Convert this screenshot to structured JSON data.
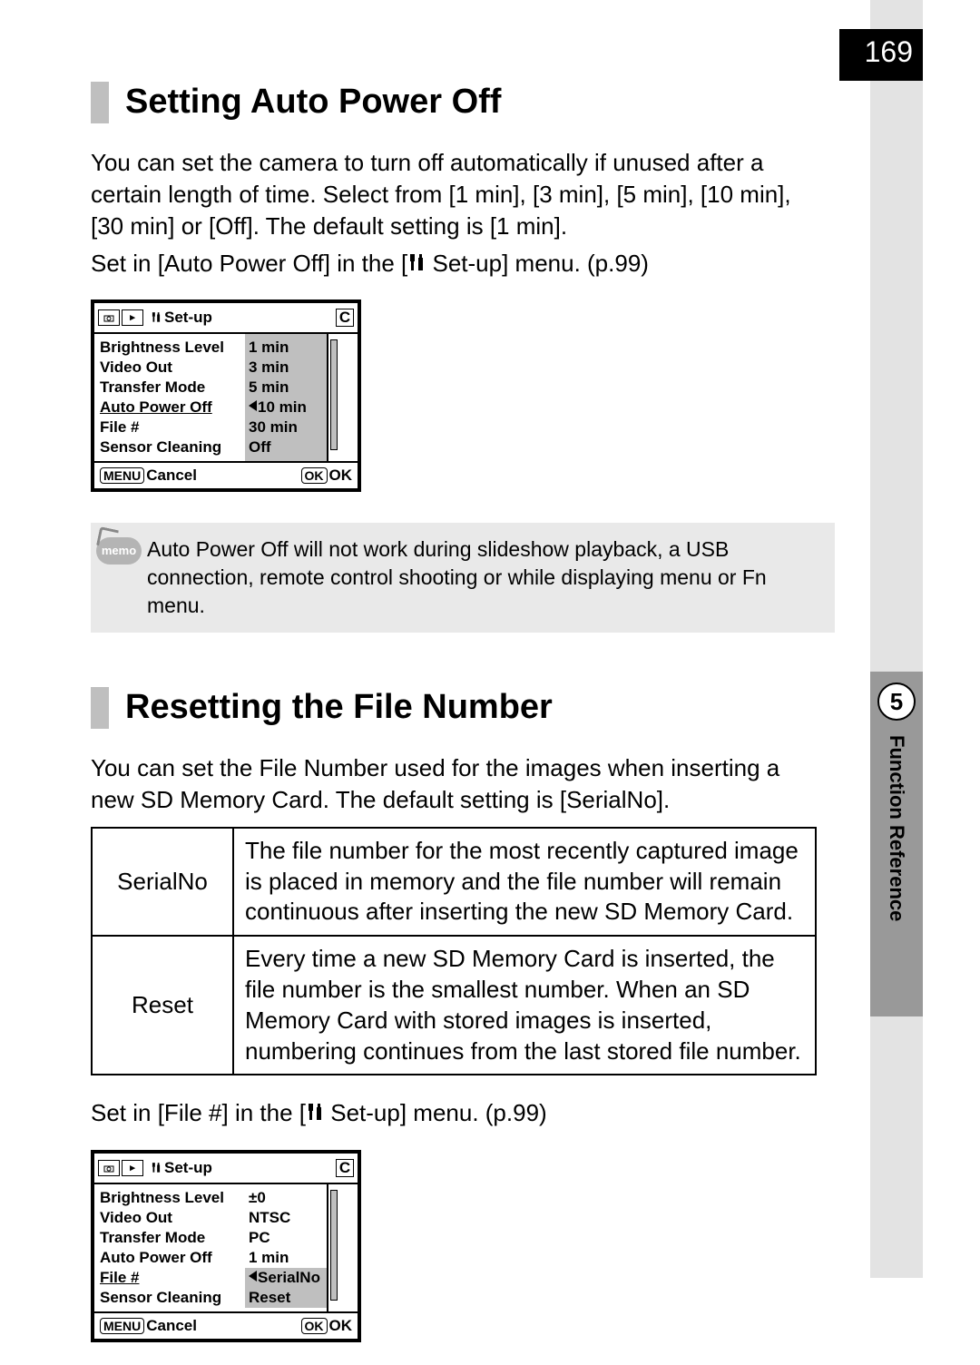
{
  "page_number": "169",
  "chapter": {
    "num": "5",
    "label": "Function Reference"
  },
  "section1": {
    "heading": "Setting Auto Power Off",
    "para1": "You can set the camera to turn off automatically if unused after a certain length of time. Select from [1 min], [3 min], [5 min], [10 min], [30 min] or [Off]. The default setting is [1 min].",
    "para2a": "Set in [Auto Power Off] in the [",
    "para2b": " Set-up] menu. (p.99)"
  },
  "lcd1": {
    "tabs_title": "Set-up",
    "tab_c": "C",
    "left": [
      "Brightness Level",
      "Video Out",
      "Transfer Mode",
      "Auto Power Off",
      "File #",
      "Sensor Cleaning"
    ],
    "right": [
      "1 min",
      "3 min",
      "5 min",
      "10 min",
      "30 min",
      "Off"
    ],
    "selected_index": 3,
    "foot_menu": "MENU",
    "foot_cancel": "Cancel",
    "foot_ok_box": "OK",
    "foot_ok": "OK"
  },
  "memo": {
    "label": "memo",
    "text": "Auto Power Off will not work during slideshow playback, a USB connection, remote control shooting or while displaying menu or Fn menu."
  },
  "section2": {
    "heading": "Resetting the File Number",
    "para1": "You can set the File Number used for the images when inserting a new SD Memory Card. The default setting is [SerialNo].",
    "table": [
      {
        "term": "SerialNo",
        "desc": "The file number for the most recently captured image is placed in memory and the file number will remain continuous after inserting the new SD Memory Card."
      },
      {
        "term": "Reset",
        "desc": "Every time a new SD Memory Card is inserted, the file number is the smallest number. When an SD Memory Card with stored images is inserted, numbering continues from the last stored file number."
      }
    ],
    "para2a": "Set in [File #] in the [",
    "para2b": " Set-up] menu. (p.99)"
  },
  "lcd2": {
    "tabs_title": "Set-up",
    "tab_c": "C",
    "left": [
      "Brightness Level",
      "Video Out",
      "Transfer Mode",
      "Auto Power Off",
      "File #",
      "Sensor Cleaning"
    ],
    "right": [
      "±0",
      "NTSC",
      "PC",
      "1 min",
      "SerialNo",
      "Reset"
    ],
    "selected_index": 4,
    "foot_menu": "MENU",
    "foot_cancel": "Cancel",
    "foot_ok_box": "OK",
    "foot_ok": "OK"
  }
}
